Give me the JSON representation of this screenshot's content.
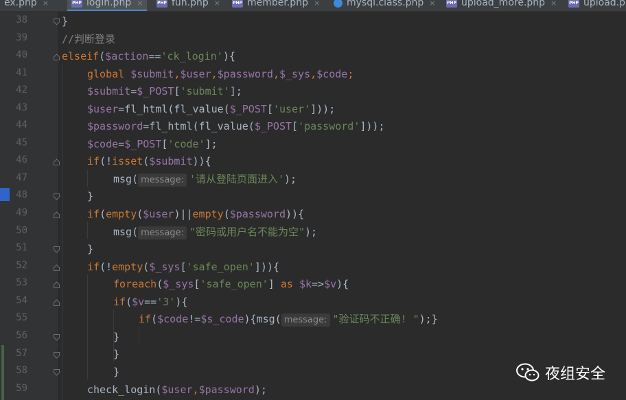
{
  "tabs": [
    {
      "label": "ex.php",
      "icon": "php",
      "active": false
    },
    {
      "label": "login.php",
      "icon": "php",
      "active": true
    },
    {
      "label": "fun.php",
      "icon": "php",
      "active": false
    },
    {
      "label": "member.php",
      "icon": "php",
      "active": false
    },
    {
      "label": "mysql.class.php",
      "icon": "c",
      "active": false
    },
    {
      "label": "upload_more.php",
      "icon": "php",
      "active": false
    },
    {
      "label": "upload.p",
      "icon": "php",
      "active": false
    }
  ],
  "tab_close_glyph": "×",
  "php_icon_text": "PHP",
  "lines": [
    "38",
    "39",
    "40",
    "41",
    "42",
    "43",
    "44",
    "45",
    "46",
    "47",
    "48",
    "49",
    "50",
    "51",
    "52",
    "53",
    "54",
    "55",
    "56",
    "57",
    "58",
    "59"
  ],
  "code": {
    "l38": "}",
    "l39": "//判断登录",
    "l40a": "elseif",
    "l40b": "(",
    "l40c": "$action",
    "l40d": "==",
    "l40e": "'ck_login'",
    "l40f": "){",
    "l41a": "global ",
    "l41b": "$submit",
    "l41c": ",",
    "l41d": "$user",
    "l41e": ",",
    "l41f": "$password",
    "l41g": ",",
    "l41h": "$_sys",
    "l41i": ",",
    "l41j": "$code",
    "l41k": ";",
    "l42a": "$submit",
    "l42b": "=",
    "l42c": "$_POST",
    "l42d": "[",
    "l42e": "'submit'",
    "l42f": "];",
    "l43a": "$user",
    "l43b": "=fl_html(fl_value(",
    "l43c": "$_POST",
    "l43d": "[",
    "l43e": "'user'",
    "l43f": "]));",
    "l44a": "$password",
    "l44b": "=fl_html(fl_value(",
    "l44c": "$_POST",
    "l44d": "[",
    "l44e": "'password'",
    "l44f": "]));",
    "l45a": "$code",
    "l45b": "=",
    "l45c": "$_POST",
    "l45d": "[",
    "l45e": "'code'",
    "l45f": "];",
    "l46a": "if",
    "l46b": "(!",
    "l46c": "isset",
    "l46d": "(",
    "l46e": "$submit",
    "l46f": ")){",
    "l47a": "msg(",
    "l47hint": "message:",
    "l47b": "'请从登陆页面进入'",
    "l47c": ");",
    "l48": "}",
    "l49a": "if",
    "l49b": "(",
    "l49c": "empty",
    "l49d": "(",
    "l49e": "$user",
    "l49f": ")||",
    "l49g": "empty",
    "l49h": "(",
    "l49i": "$password",
    "l49j": ")){",
    "l50a": "msg(",
    "l50hint": "message:",
    "l50b": "\"密码或用户名不能为空\"",
    "l50c": ");",
    "l51": "}",
    "l52a": "if",
    "l52b": "(!",
    "l52c": "empty",
    "l52d": "(",
    "l52e": "$_sys",
    "l52f": "[",
    "l52g": "'safe_open'",
    "l52h": "])){",
    "l53a": "foreach",
    "l53b": "(",
    "l53c": "$_sys",
    "l53d": "[",
    "l53e": "'safe_open'",
    "l53f": "] ",
    "l53g": "as ",
    "l53h": "$k",
    "l53i": "=>",
    "l53j": "$v",
    "l53k": "){",
    "l54a": "if",
    "l54b": "(",
    "l54c": "$v",
    "l54d": "==",
    "l54e": "'3'",
    "l54f": "){",
    "l55a": "if",
    "l55b": "(",
    "l55c": "$code",
    "l55d": "!=",
    "l55e": "$s_code",
    "l55f": "){msg(",
    "l55hint": "message:",
    "l55g": "\"验证码不正确! \"",
    "l55h": ");}",
    "l56": "}",
    "l57": "}",
    "l58": "}",
    "l59a": "check_login(",
    "l59b": "$user",
    "l59c": ",",
    "l59d": "$password",
    "l59e": ");"
  },
  "watermark": {
    "text": "夜组安全",
    "icon": "wechat-icon"
  },
  "colors": {
    "bg": "#2b2b2b",
    "keyword": "#cc7832",
    "variable": "#9876aa",
    "string": "#6a8759",
    "comment": "#808080",
    "text": "#a9b7c6"
  }
}
